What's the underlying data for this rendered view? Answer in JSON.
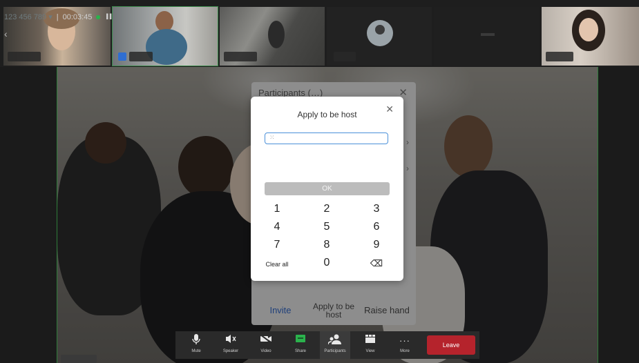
{
  "header": {
    "meeting_id": "123 456 789 ▾",
    "separator": "|",
    "duration": "00:03:45",
    "signal_label": "▐▐",
    "back_icon": "chevron-left-icon"
  },
  "participants_panel": {
    "title": "Participants (…)",
    "close_icon": "close-icon",
    "row_arrow": "›",
    "footer": {
      "invite": "Invite",
      "apply_host": "Apply to be host",
      "raise_hand": "Raise hand"
    }
  },
  "dialog": {
    "title": "Apply to be host",
    "close": "✕",
    "input_value": "",
    "input_glyph": "⁙",
    "ok": "OK",
    "keys": [
      "1",
      "2",
      "3",
      "4",
      "5",
      "6",
      "7",
      "8",
      "9",
      "Clear all",
      "0",
      "⌫"
    ]
  },
  "toolbar": {
    "items": [
      {
        "label": "Mute",
        "icon": "microphone-icon"
      },
      {
        "label": "Speaker",
        "icon": "speaker-muted-icon"
      },
      {
        "label": "Video",
        "icon": "video-off-icon"
      },
      {
        "label": "Share",
        "icon": "share-screen-icon"
      },
      {
        "label": "Participants",
        "icon": "participants-icon"
      },
      {
        "label": "View",
        "icon": "view-grid-icon"
      },
      {
        "label": "More",
        "icon": "more-icon"
      }
    ],
    "leave": "Leave",
    "colors": {
      "leave": "#b5232c",
      "share_icon": "#2bb24c",
      "active_border": "#2e7d3a",
      "input_border": "#4a90d9"
    }
  }
}
